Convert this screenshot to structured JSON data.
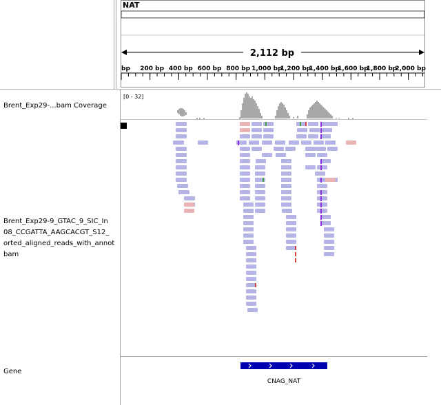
{
  "ruler": {
    "chrom": "NAT",
    "span": "2,112 bp",
    "ticks": [
      {
        "bp": 0,
        "label": "bp"
      },
      {
        "bp": 200,
        "label": "200 bp"
      },
      {
        "bp": 400,
        "label": "400 bp"
      },
      {
        "bp": 600,
        "label": "600 bp"
      },
      {
        "bp": 800,
        "label": "800 bp"
      },
      {
        "bp": 1000,
        "label": "1,000 bp"
      },
      {
        "bp": 1200,
        "label": "1,200 bp"
      },
      {
        "bp": 1400,
        "label": "1,400 bp"
      },
      {
        "bp": 1600,
        "label": "1,600 bp"
      },
      {
        "bp": 1800,
        "label": "1,800 bp"
      },
      {
        "bp": 2000,
        "label": "2,000 bp"
      }
    ]
  },
  "tracks": {
    "coverage_name": "Brent_Exp29-...bam Coverage",
    "coverage_range": "[0 - 32]",
    "alignment_name_lines": [
      "Brent_Exp29-9_GTAC_9_SIC_In",
      "08_CCGATTA_AAGCACGT_S12_",
      "orted_aligned_reads_with_annot",
      "bam"
    ],
    "gene_name": "Gene",
    "gene_feature": "CNAG_NAT"
  },
  "colors": {
    "coverage": "#a8a8a8",
    "read": "#b4b4e6",
    "read_pair_alt": "#e8b4b4",
    "insertion": "#8a2be2",
    "gene": "#0000b0",
    "mismatch_red": "#d04040",
    "mismatch_green": "#40a040"
  },
  "icons": {
    "strand_arrow": "chevron-right-icon",
    "black_marker": "square-marker"
  }
}
